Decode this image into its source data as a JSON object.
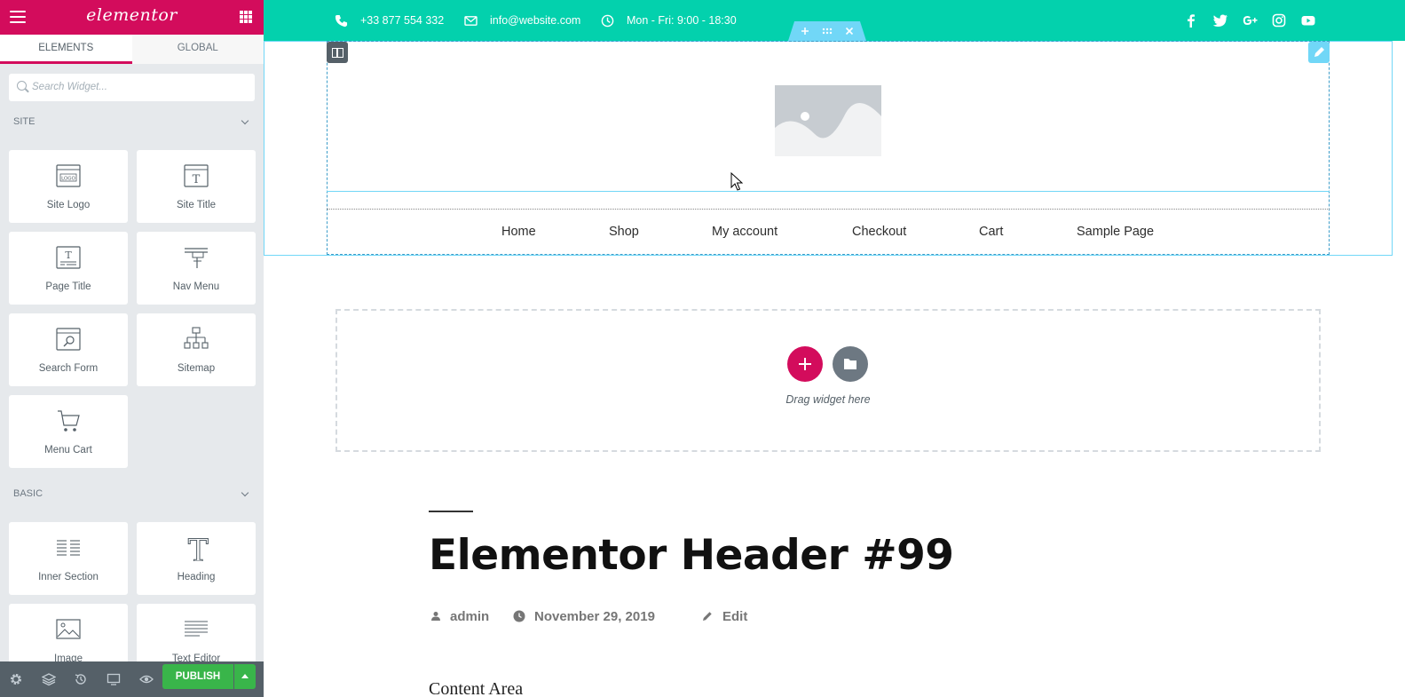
{
  "sidebar": {
    "brand": "elementor",
    "tabs": [
      {
        "label": "ELEMENTS",
        "active": true
      },
      {
        "label": "GLOBAL",
        "active": false
      }
    ],
    "search": {
      "placeholder": "Search Widget...",
      "value": ""
    },
    "categories": {
      "site": "SITE",
      "basic": "BASIC"
    },
    "site_widgets": [
      {
        "label": "Site Logo",
        "icon": "site-logo-icon"
      },
      {
        "label": "Site Title",
        "icon": "site-title-icon"
      },
      {
        "label": "Page Title",
        "icon": "page-title-icon"
      },
      {
        "label": "Nav Menu",
        "icon": "nav-menu-icon"
      },
      {
        "label": "Search Form",
        "icon": "search-form-icon"
      },
      {
        "label": "Sitemap",
        "icon": "sitemap-icon"
      },
      {
        "label": "Menu Cart",
        "icon": "cart-icon"
      }
    ],
    "basic_widgets": [
      {
        "label": "Inner Section",
        "icon": "columns-icon"
      },
      {
        "label": "Heading",
        "icon": "heading-icon"
      },
      {
        "label": "Image",
        "icon": "image-icon"
      },
      {
        "label": "Text Editor",
        "icon": "text-editor-icon"
      }
    ],
    "footer": {
      "publish_label": "PUBLISH",
      "icons": [
        "settings-icon",
        "navigator-icon",
        "history-icon",
        "responsive-icon",
        "preview-icon"
      ]
    }
  },
  "canvas": {
    "topbar": {
      "phone": "+33 877 554 332",
      "email": "info@website.com",
      "hours": "Mon - Fri: 9:00 - 18:30",
      "social": [
        "facebook-icon",
        "twitter-icon",
        "google-plus-icon",
        "instagram-icon",
        "youtube-icon"
      ]
    },
    "nav": [
      "Home",
      "Shop",
      "My account",
      "Checkout",
      "Cart",
      "Sample Page"
    ],
    "drop_area": {
      "text": "Drag widget here"
    },
    "post": {
      "title": "Elementor Header #99",
      "author": "admin",
      "date": "November 29, 2019",
      "edit": "Edit",
      "content_start": "Content Area"
    }
  },
  "colors": {
    "brand": "#d30c5c",
    "topbar": "#03d1ad",
    "publish": "#39b54a",
    "sidebar_bg": "#e6e9ec",
    "edit_outline": "#71d7f7"
  }
}
